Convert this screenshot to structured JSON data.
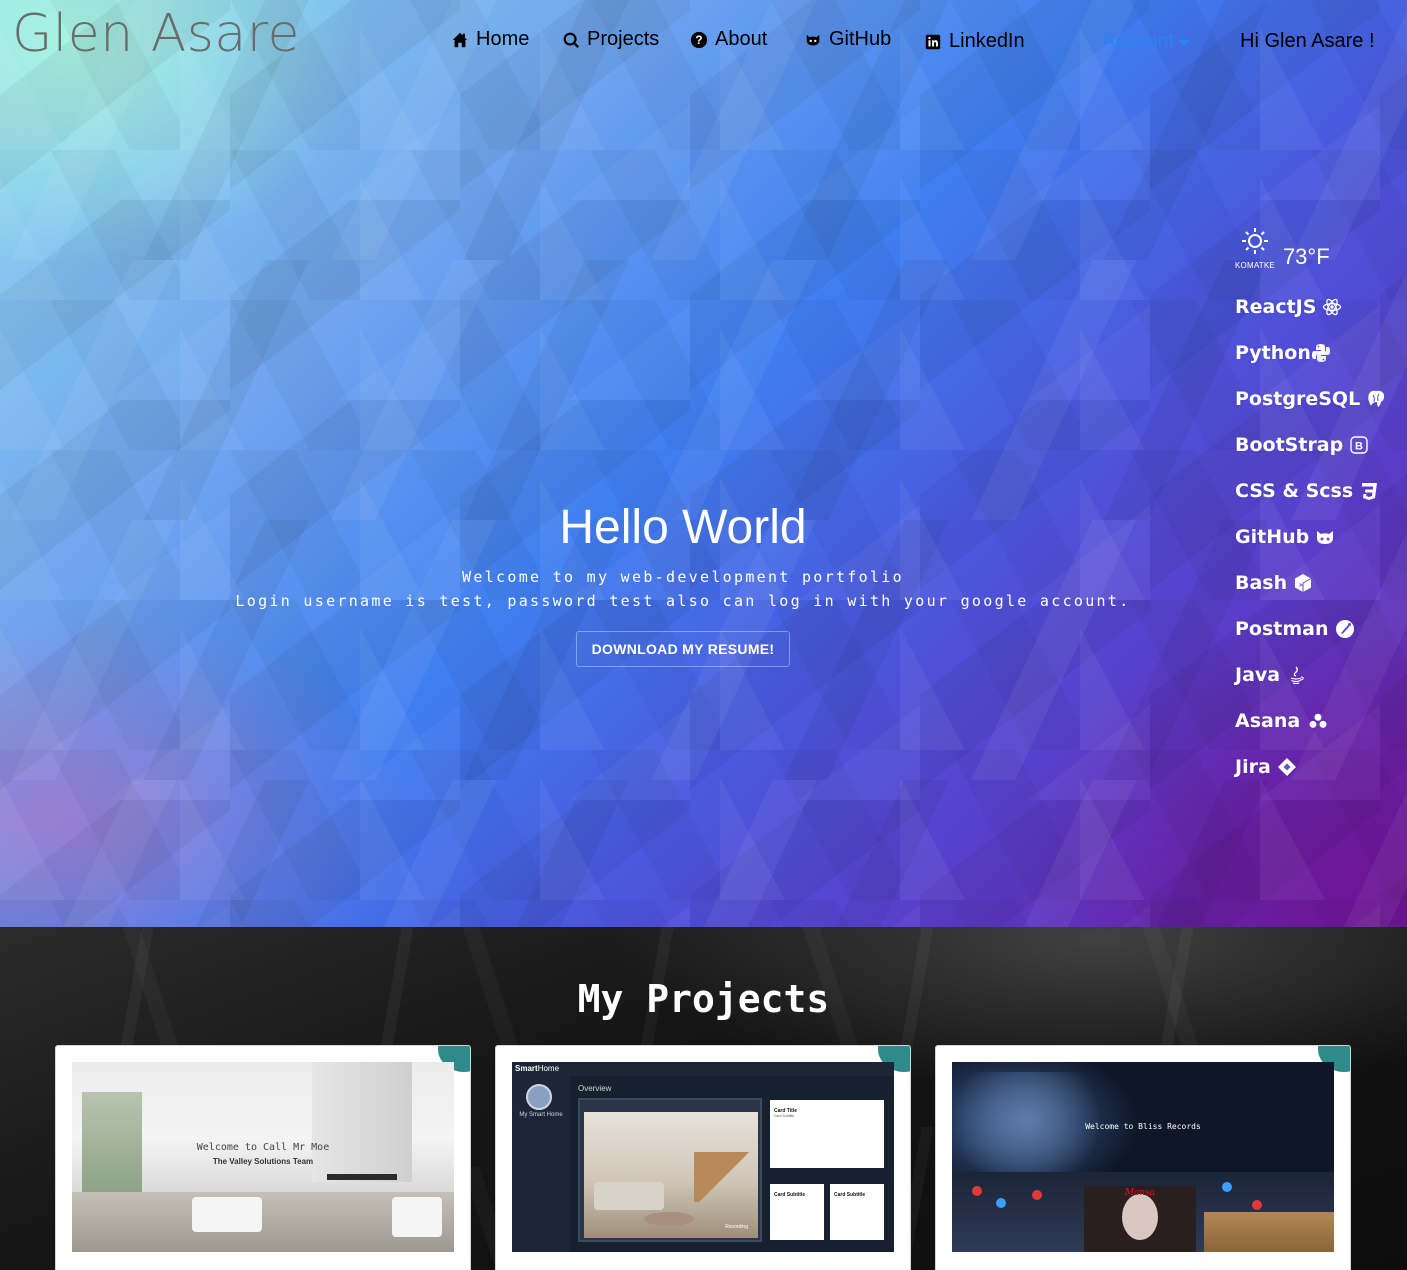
{
  "brand": "Glen Asare",
  "nav": {
    "items": [
      {
        "label": "Home",
        "icon": "home-icon"
      },
      {
        "label": "Projects",
        "icon": "search-icon"
      },
      {
        "label": "About",
        "icon": "question-icon"
      },
      {
        "label": "GitHub",
        "icon": "github-icon"
      },
      {
        "label": "LinkedIn",
        "icon": "linkedin-icon"
      }
    ],
    "account_label": "Account",
    "greeting": "Hi Glen Asare !"
  },
  "weather": {
    "location": "KOMATKE",
    "temperature": "73°F",
    "icon": "sun-icon"
  },
  "skills": [
    {
      "label": "ReactJS",
      "icon": "react-icon"
    },
    {
      "label": "Python",
      "icon": "python-icon"
    },
    {
      "label": "PostgreSQL",
      "icon": "postgresql-icon"
    },
    {
      "label": "BootStrap",
      "icon": "bootstrap-icon"
    },
    {
      "label": "CSS & Scss",
      "icon": "css-icon"
    },
    {
      "label": "GitHub",
      "icon": "github-icon"
    },
    {
      "label": "Bash",
      "icon": "bash-icon"
    },
    {
      "label": "Postman",
      "icon": "postman-icon"
    },
    {
      "label": "Java",
      "icon": "java-icon"
    },
    {
      "label": "Asana",
      "icon": "asana-icon"
    },
    {
      "label": "Jira",
      "icon": "jira-icon"
    }
  ],
  "hero": {
    "title": "Hello World",
    "line1": "Welcome to my web-development portfolio",
    "line2": "Login username is test, password test also can log in with your google account.",
    "resume_button": "DOWNLOAD MY RESUME!"
  },
  "projects": {
    "title": "My Projects",
    "cards": [
      {
        "heading": "Welcome to Call Mr Moe",
        "subheading": "The Valley Solutions Team"
      },
      {
        "logo_bold": "Smart",
        "logo_rest": "Home",
        "user_name": "My Smart Home",
        "section": "Overview",
        "recording": "Recording",
        "card_title": "Card Title",
        "card_subtitle": "Card Subtitle"
      },
      {
        "heading": "Welcome to Bliss Records",
        "poster_text": "Mansa"
      }
    ]
  },
  "colors": {
    "accent": "#2a82f5",
    "card_corner": "#2f8a8a"
  }
}
